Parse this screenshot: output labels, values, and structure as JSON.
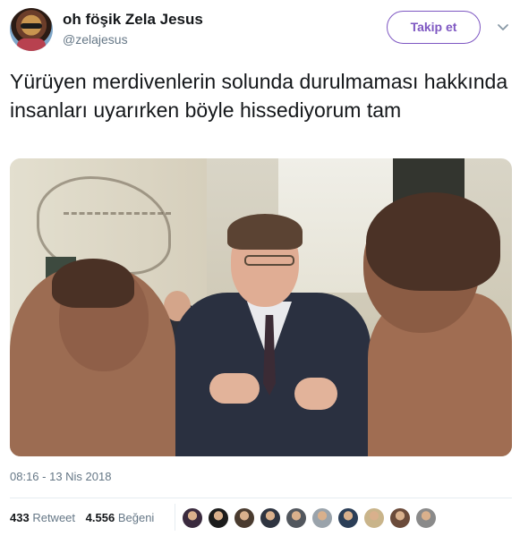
{
  "user": {
    "display_name": "oh föşik Zela Jesus",
    "handle": "@zelajesus",
    "follow_label": "Takip et"
  },
  "tweet": {
    "text": "Yürüyen merdivenlerin solunda durulmaması hakkında insanları uyarırken böyle hissediyorum tam",
    "timestamp": "08:16 - 13 Nis 2018"
  },
  "stats": {
    "retweet_count": "433",
    "retweet_label": "Retweet",
    "like_count": "4.556",
    "like_label": "Beğeni"
  },
  "liker_avatars": [
    {
      "color": "#3a2a3e"
    },
    {
      "color": "#1c1c1c"
    },
    {
      "color": "#4a3b2f"
    },
    {
      "color": "#2e3440"
    },
    {
      "color": "#52575e"
    },
    {
      "color": "#9aa3ab"
    },
    {
      "color": "#2b3e57"
    },
    {
      "color": "#c9b48a"
    },
    {
      "color": "#6b4b3a"
    },
    {
      "color": "#8a8a8a"
    }
  ],
  "colors": {
    "accent": "#7e57c2",
    "text": "#14171a",
    "muted": "#657786"
  }
}
